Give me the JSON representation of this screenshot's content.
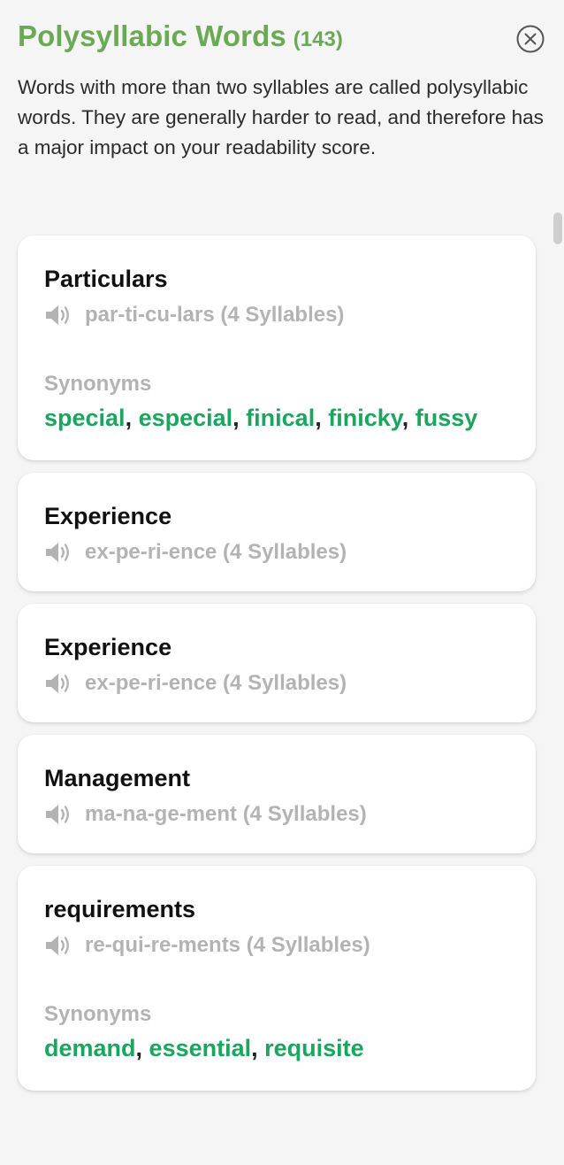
{
  "header": {
    "title": "Polysyllabic Words",
    "count": "(143)",
    "description": "Words with more than two syllables are called polysyllabic words. They are generally harder to read, and therefore has a major impact on your readability score."
  },
  "colors": {
    "accent": "#6aaa55",
    "synonym": "#1aa65e",
    "muted": "#b3b3b3"
  },
  "icons": {
    "close": "close-circle-icon",
    "speaker": "speaker-icon"
  },
  "cards": [
    {
      "word": "Particulars",
      "syllables": "par-ti-cu-lars (4 Syllables)",
      "synonyms_label": "Synonyms",
      "synonyms": [
        "special",
        "especial",
        "finical",
        "finicky",
        "fussy"
      ]
    },
    {
      "word": "Experience",
      "syllables": "ex-pe-ri-ence (4 Syllables)"
    },
    {
      "word": "Experience",
      "syllables": "ex-pe-ri-ence (4 Syllables)"
    },
    {
      "word": "Management",
      "syllables": "ma-na-ge-ment (4 Syllables)"
    },
    {
      "word": "requirements",
      "syllables": "re-qui-re-ments (4 Syllables)",
      "synonyms_label": "Synonyms",
      "synonyms": [
        "demand",
        "essential",
        "requisite"
      ]
    }
  ]
}
